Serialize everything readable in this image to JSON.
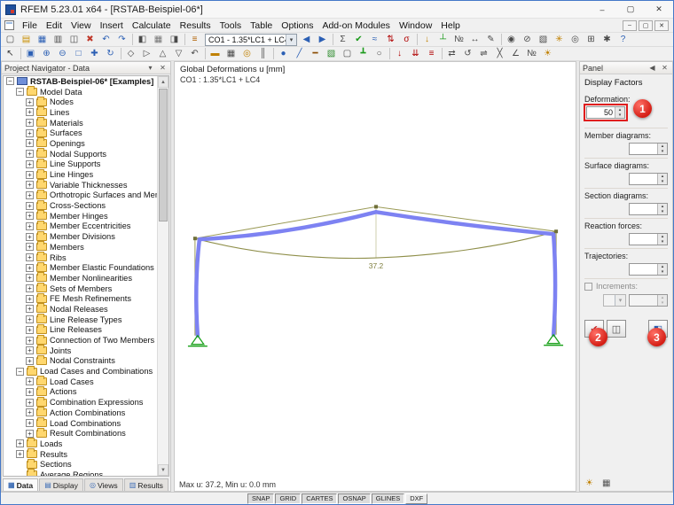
{
  "ui": {
    "chevron_down": "▾",
    "spinner_up": "▴",
    "spinner_down": "▾",
    "arrow_up": "▲",
    "arrow_down": "▼"
  },
  "colors": {
    "annotation_red": "#e01e1e",
    "deformed_member_blue": "#7d82f2",
    "diagram_olive": "#8f8f4a",
    "support_green": "#18a018"
  },
  "titlebar": {
    "title": "RFEM 5.23.01 x64 - [RSTAB-Beispiel-06*]",
    "buttons": {
      "minimize": "–",
      "maximize": "▢",
      "close": "✕"
    }
  },
  "menubar": {
    "items": [
      "File",
      "Edit",
      "View",
      "Insert",
      "Calculate",
      "Results",
      "Tools",
      "Table",
      "Options",
      "Add-on Modules",
      "Window",
      "Help"
    ],
    "child_controls": [
      {
        "name": "child-minimize-icon",
        "glyph": "–"
      },
      {
        "name": "child-restore-icon",
        "glyph": "▢"
      },
      {
        "name": "child-close-icon",
        "glyph": "✕"
      }
    ]
  },
  "toolbar1": {
    "left": [
      {
        "name": "new-model-icon",
        "glyph": "▢",
        "color": "#4a4a4a"
      },
      {
        "name": "open-model-icon",
        "glyph": "▤",
        "color": "#c98f00"
      },
      {
        "name": "save-model-icon",
        "glyph": "▦",
        "color": "#2b5fb4"
      },
      {
        "name": "print-icon",
        "glyph": "▥",
        "color": "#4a4a4a"
      },
      {
        "name": "copy-icon",
        "glyph": "◫",
        "color": "#4a4a4a"
      },
      {
        "name": "delete-icon",
        "glyph": "✖",
        "color": "#c0392b"
      },
      {
        "name": "undo-icon",
        "glyph": "↶",
        "color": "#2b5fb4"
      },
      {
        "name": "redo-icon",
        "glyph": "↷",
        "color": "#2b5fb4"
      },
      {
        "name": "separator"
      },
      {
        "name": "navigator-toggle-icon",
        "glyph": "◧",
        "color": "#4a4a4a"
      },
      {
        "name": "tables-toggle-icon",
        "glyph": "▦",
        "color": "#777777"
      },
      {
        "name": "panel-toggle-icon",
        "glyph": "◨",
        "color": "#4a4a4a"
      },
      {
        "name": "separator"
      },
      {
        "name": "load-cases-icon",
        "glyph": "≡",
        "color": "#b06000"
      }
    ],
    "combo": "CO1 - 1.35*LC1 + LC4",
    "right": [
      {
        "name": "previous-load-case-icon",
        "glyph": "◀",
        "color": "#2b5fb4"
      },
      {
        "name": "next-load-case-icon",
        "glyph": "▶",
        "color": "#2b5fb4"
      },
      {
        "name": "separator"
      },
      {
        "name": "calculation-icon",
        "glyph": "Σ",
        "color": "#4a4a4a"
      },
      {
        "name": "check-calculation-icon",
        "glyph": "✔",
        "color": "#1a9a1a"
      },
      {
        "name": "results-toggle-icon",
        "glyph": "≈",
        "color": "#2b5fb4"
      },
      {
        "name": "internal-forces-icon",
        "glyph": "⇅",
        "color": "#b00000"
      },
      {
        "name": "stresses-icon",
        "glyph": "σ",
        "color": "#b00000"
      },
      {
        "name": "separator"
      },
      {
        "name": "show-loads-icon",
        "glyph": "↓",
        "color": "#c08000"
      },
      {
        "name": "show-supports-icon",
        "glyph": "┴",
        "color": "#1a9a1a"
      },
      {
        "name": "show-numbering-icon",
        "glyph": "№",
        "color": "#4a4a4a"
      },
      {
        "name": "dimensions-icon",
        "glyph": "↔",
        "color": "#4a4a4a"
      },
      {
        "name": "comment-icon",
        "glyph": "✎",
        "color": "#4a4a4a"
      },
      {
        "name": "separator"
      },
      {
        "name": "visibility-icon",
        "glyph": "◉",
        "color": "#4a4a4a"
      },
      {
        "name": "clipping-icon",
        "glyph": "⊘",
        "color": "#4a4a4a"
      },
      {
        "name": "render-mode-icon",
        "glyph": "▧",
        "color": "#4a4a4a"
      },
      {
        "name": "light-icon",
        "glyph": "✳",
        "color": "#c08000"
      },
      {
        "name": "camera-icon",
        "glyph": "◎",
        "color": "#4a4a4a"
      },
      {
        "name": "modules-icon",
        "glyph": "⊞",
        "color": "#4a4a4a"
      },
      {
        "name": "settings-icon",
        "glyph": "✱",
        "color": "#4a4a4a"
      },
      {
        "name": "help-icon",
        "glyph": "?",
        "color": "#2b5fb4"
      }
    ]
  },
  "toolbar2": {
    "icons": [
      {
        "name": "select-pointer-icon",
        "glyph": "↖",
        "color": "#333333"
      },
      {
        "name": "separator"
      },
      {
        "name": "zoom-window-icon",
        "glyph": "▣",
        "color": "#2b5fb4"
      },
      {
        "name": "zoom-in-icon",
        "glyph": "⊕",
        "color": "#2b5fb4"
      },
      {
        "name": "zoom-out-icon",
        "glyph": "⊖",
        "color": "#2b5fb4"
      },
      {
        "name": "zoom-all-icon",
        "glyph": "□",
        "color": "#2b5fb4"
      },
      {
        "name": "pan-icon",
        "glyph": "✚",
        "color": "#2b5fb4"
      },
      {
        "name": "rotate-view-icon",
        "glyph": "↻",
        "color": "#2b5fb4"
      },
      {
        "name": "separator"
      },
      {
        "name": "view-isometric-icon",
        "glyph": "◇",
        "color": "#4a4a4a"
      },
      {
        "name": "view-x-icon",
        "glyph": "▷",
        "color": "#4a4a4a"
      },
      {
        "name": "view-y-icon",
        "glyph": "△",
        "color": "#4a4a4a"
      },
      {
        "name": "view-z-icon",
        "glyph": "▽",
        "color": "#4a4a4a"
      },
      {
        "name": "previous-view-icon",
        "glyph": "↶",
        "color": "#4a4a4a"
      },
      {
        "name": "separator"
      },
      {
        "name": "work-plane-icon",
        "glyph": "▬",
        "color": "#c08000"
      },
      {
        "name": "grid-icon",
        "glyph": "▦",
        "color": "#4a4a4a"
      },
      {
        "name": "snap-icon",
        "glyph": "◎",
        "color": "#c08000"
      },
      {
        "name": "guidelines-icon",
        "glyph": "║",
        "color": "#4a4a4a"
      },
      {
        "name": "separator"
      },
      {
        "name": "node-icon",
        "glyph": "●",
        "color": "#2b5fb4"
      },
      {
        "name": "line-icon",
        "glyph": "╱",
        "color": "#2b5fb4"
      },
      {
        "name": "member-icon",
        "glyph": "━",
        "color": "#8a4b00"
      },
      {
        "name": "surface-icon",
        "glyph": "▧",
        "color": "#2b8a2b"
      },
      {
        "name": "opening-icon",
        "glyph": "▢",
        "color": "#4a4a4a"
      },
      {
        "name": "support-icon",
        "glyph": "┻",
        "color": "#1a9a1a"
      },
      {
        "name": "hinge-icon",
        "glyph": "○",
        "color": "#4a4a4a"
      },
      {
        "name": "separator"
      },
      {
        "name": "nodal-load-icon",
        "glyph": "↓",
        "color": "#b00000"
      },
      {
        "name": "member-load-icon",
        "glyph": "⇊",
        "color": "#b00000"
      },
      {
        "name": "surface-load-icon",
        "glyph": "≡",
        "color": "#b00000"
      },
      {
        "name": "separator"
      },
      {
        "name": "move-icon",
        "glyph": "⇄",
        "color": "#4a4a4a"
      },
      {
        "name": "rotate-object-icon",
        "glyph": "↺",
        "color": "#4a4a4a"
      },
      {
        "name": "mirror-icon",
        "glyph": "⇌",
        "color": "#4a4a4a"
      },
      {
        "name": "divide-icon",
        "glyph": "╳",
        "color": "#4a4a4a"
      },
      {
        "name": "measure-icon",
        "glyph": "∠",
        "color": "#4a4a4a"
      },
      {
        "name": "numbering-icon",
        "glyph": "№",
        "color": "#4a4a4a"
      },
      {
        "name": "display-properties-icon",
        "glyph": "☀",
        "color": "#c08000"
      }
    ]
  },
  "navigator": {
    "title": "Project Navigator - Data",
    "header_icons": [
      {
        "name": "pin-icon",
        "glyph": "▾"
      },
      {
        "name": "close-icon",
        "glyph": "✕"
      }
    ],
    "tree": [
      {
        "name": "tree-item-project",
        "label": "RSTAB-Beispiel-06* [Examples]",
        "level": 0,
        "expand": "minus",
        "icon": "model",
        "bold": true
      },
      {
        "name": "tree-item-model-data",
        "label": "Model Data",
        "level": 1,
        "expand": "minus",
        "icon": "folder"
      },
      {
        "name": "tree-item-nodes",
        "label": "Nodes",
        "level": 2,
        "expand": "plus",
        "icon": "folder"
      },
      {
        "name": "tree-item-lines",
        "label": "Lines",
        "level": 2,
        "expand": "plus",
        "icon": "folder"
      },
      {
        "name": "tree-item-materials",
        "label": "Materials",
        "level": 2,
        "expand": "plus",
        "icon": "folder"
      },
      {
        "name": "tree-item-surfaces",
        "label": "Surfaces",
        "level": 2,
        "expand": "plus",
        "icon": "folder"
      },
      {
        "name": "tree-item-openings",
        "label": "Openings",
        "level": 2,
        "expand": "plus",
        "icon": "folder"
      },
      {
        "name": "tree-item-nodal-supports",
        "label": "Nodal Supports",
        "level": 2,
        "expand": "plus",
        "icon": "folder"
      },
      {
        "name": "tree-item-line-supports",
        "label": "Line Supports",
        "level": 2,
        "expand": "plus",
        "icon": "folder"
      },
      {
        "name": "tree-item-line-hinges",
        "label": "Line Hinges",
        "level": 2,
        "expand": "plus",
        "icon": "folder"
      },
      {
        "name": "tree-item-variable-thicknesses",
        "label": "Variable Thicknesses",
        "level": 2,
        "expand": "plus",
        "icon": "folder"
      },
      {
        "name": "tree-item-orthotropic",
        "label": "Orthotropic Surfaces and Membrane",
        "level": 2,
        "expand": "plus",
        "icon": "folder"
      },
      {
        "name": "tree-item-cross-sections",
        "label": "Cross-Sections",
        "level": 2,
        "expand": "plus",
        "icon": "folder"
      },
      {
        "name": "tree-item-member-hinges",
        "label": "Member Hinges",
        "level": 2,
        "expand": "plus",
        "icon": "folder"
      },
      {
        "name": "tree-item-member-eccentricities",
        "label": "Member Eccentricities",
        "level": 2,
        "expand": "plus",
        "icon": "folder"
      },
      {
        "name": "tree-item-member-divisions",
        "label": "Member Divisions",
        "level": 2,
        "expand": "plus",
        "icon": "folder"
      },
      {
        "name": "tree-item-members",
        "label": "Members",
        "level": 2,
        "expand": "plus",
        "icon": "folder"
      },
      {
        "name": "tree-item-ribs",
        "label": "Ribs",
        "level": 2,
        "expand": "plus",
        "icon": "folder"
      },
      {
        "name": "tree-item-member-elastic-foundations",
        "label": "Member Elastic Foundations",
        "level": 2,
        "expand": "plus",
        "icon": "folder"
      },
      {
        "name": "tree-item-member-nonlinearities",
        "label": "Member Nonlinearities",
        "level": 2,
        "expand": "plus",
        "icon": "folder"
      },
      {
        "name": "tree-item-sets-of-members",
        "label": "Sets of Members",
        "level": 2,
        "expand": "plus",
        "icon": "folder"
      },
      {
        "name": "tree-item-fe-mesh-refinements",
        "label": "FE Mesh Refinements",
        "level": 2,
        "expand": "plus",
        "icon": "folder"
      },
      {
        "name": "tree-item-nodal-releases",
        "label": "Nodal Releases",
        "level": 2,
        "expand": "plus",
        "icon": "folder"
      },
      {
        "name": "tree-item-line-release-types",
        "label": "Line Release Types",
        "level": 2,
        "expand": "plus",
        "icon": "folder"
      },
      {
        "name": "tree-item-line-releases",
        "label": "Line Releases",
        "level": 2,
        "expand": "plus",
        "icon": "folder"
      },
      {
        "name": "tree-item-connection-two-members",
        "label": "Connection of Two Members",
        "level": 2,
        "expand": "plus",
        "icon": "folder"
      },
      {
        "name": "tree-item-joints",
        "label": "Joints",
        "level": 2,
        "expand": "plus",
        "icon": "folder"
      },
      {
        "name": "tree-item-nodal-constraints",
        "label": "Nodal Constraints",
        "level": 2,
        "expand": "plus",
        "icon": "folder"
      },
      {
        "name": "tree-item-load-cases-and-combinations",
        "label": "Load Cases and Combinations",
        "level": 1,
        "expand": "minus",
        "icon": "folder"
      },
      {
        "name": "tree-item-load-cases",
        "label": "Load Cases",
        "level": 2,
        "expand": "plus",
        "icon": "folder"
      },
      {
        "name": "tree-item-actions",
        "label": "Actions",
        "level": 2,
        "expand": "plus",
        "icon": "folder"
      },
      {
        "name": "tree-item-combination-expressions",
        "label": "Combination Expressions",
        "level": 2,
        "expand": "plus",
        "icon": "folder"
      },
      {
        "name": "tree-item-action-combinations",
        "label": "Action Combinations",
        "level": 2,
        "expand": "plus",
        "icon": "folder"
      },
      {
        "name": "tree-item-load-combinations",
        "label": "Load Combinations",
        "level": 2,
        "expand": "plus",
        "icon": "folder"
      },
      {
        "name": "tree-item-result-combinations",
        "label": "Result Combinations",
        "level": 2,
        "expand": "plus",
        "icon": "folder"
      },
      {
        "name": "tree-item-loads",
        "label": "Loads",
        "level": 1,
        "expand": "plus",
        "icon": "folder"
      },
      {
        "name": "tree-item-results",
        "label": "Results",
        "level": 1,
        "expand": "plus",
        "icon": "folder"
      },
      {
        "name": "tree-item-sections",
        "label": "Sections",
        "level": 1,
        "expand": "none",
        "icon": "folder"
      },
      {
        "name": "tree-item-average-regions",
        "label": "Average Regions",
        "level": 1,
        "expand": "none",
        "icon": "folder"
      }
    ],
    "tabs": [
      {
        "name": "tab-data",
        "label": "Data",
        "icon": "▦",
        "active": true
      },
      {
        "name": "tab-display",
        "label": "Display",
        "icon": "▤",
        "active": false
      },
      {
        "name": "tab-views",
        "label": "Views",
        "icon": "◎",
        "active": false
      },
      {
        "name": "tab-results",
        "label": "Results",
        "icon": "▥",
        "active": false
      }
    ]
  },
  "canvas": {
    "header_line1": "Global Deformations u [mm]",
    "header_line2": "CO1 : 1.35*LC1 + LC4",
    "deformation_label": "37.2",
    "status": "Max u: 37.2, Min u: 0.0 mm"
  },
  "panel": {
    "title": "Panel",
    "header_icons": [
      {
        "name": "collapse-icon",
        "glyph": "◀"
      },
      {
        "name": "close-icon",
        "glyph": "✕"
      }
    ],
    "section_title": "Display Factors",
    "factors": [
      {
        "name": "deformation-factor",
        "label": "Deformation:",
        "value": "50",
        "highlight": true,
        "tall": true
      },
      {
        "name": "member-diagrams-factor",
        "label": "Member diagrams:",
        "value": ""
      },
      {
        "name": "surface-diagrams-factor",
        "label": "Surface diagrams:",
        "value": ""
      },
      {
        "name": "section-diagrams-factor",
        "label": "Section diagrams:",
        "value": ""
      },
      {
        "name": "reaction-forces-factor",
        "label": "Reaction forces:",
        "value": ""
      },
      {
        "name": "trajectories-factor",
        "label": "Trajectories:",
        "value": ""
      }
    ],
    "increments_label": "Increments:",
    "buttons": [
      {
        "name": "apply-factors-button",
        "glyph": "✔",
        "color": "#cc2222"
      },
      {
        "name": "reset-factors-button",
        "glyph": "◫",
        "color": "#555555"
      },
      {
        "name": "panel-dock-button",
        "glyph": "◧",
        "color": "#2b5fb4",
        "right": true
      }
    ],
    "bottom_icons": [
      {
        "name": "display-properties-icon",
        "glyph": "☀",
        "color": "#c08000"
      },
      {
        "name": "panel-views-icon",
        "glyph": "▦",
        "color": "#555555"
      }
    ],
    "badges": [
      "1",
      "2",
      "3"
    ]
  },
  "statusbar": {
    "toggles": [
      {
        "name": "snap-toggle",
        "label": "SNAP",
        "active": true
      },
      {
        "name": "grid-toggle",
        "label": "GRID",
        "active": true
      },
      {
        "name": "cartes-toggle",
        "label": "CARTES",
        "active": true
      },
      {
        "name": "osnap-toggle",
        "label": "OSNAP",
        "active": true
      },
      {
        "name": "glines-toggle",
        "label": "GLINES",
        "active": true
      },
      {
        "name": "dxf-toggle",
        "label": "DXF",
        "active": false
      }
    ]
  }
}
